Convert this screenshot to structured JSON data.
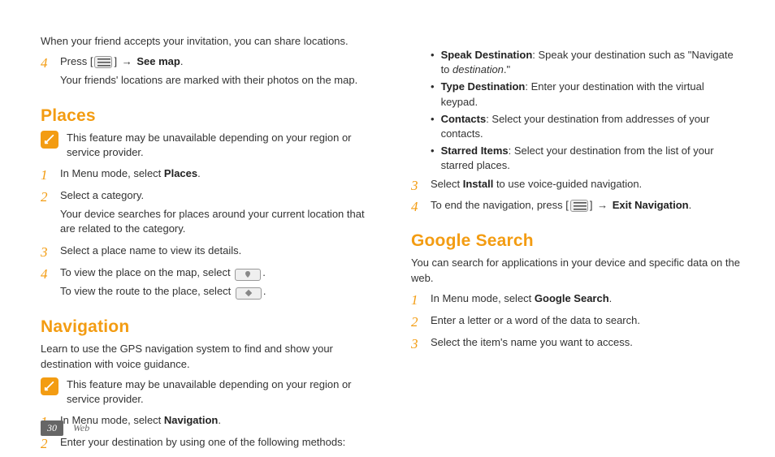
{
  "left": {
    "intro4_pre": "When your friend accepts your invitation, you can share locations.",
    "step4a_pre": "Press [",
    "step4a_arrow": " → ",
    "step4a_bold": "See map",
    "step4a_post": ".",
    "step4a_sub": "Your friends' locations are marked with their photos on the map.",
    "places_title": "Places",
    "places_note": "This feature may be unavailable depending on your region or service provider.",
    "places_step1_pre": "In Menu mode, select ",
    "places_step1_bold": "Places",
    "places_step1_post": ".",
    "places_step2": "Select a category.",
    "places_step2_sub": "Your device searches for places around your current location that are related to the category.",
    "places_step3": "Select a place name to view its details.",
    "places_step4_pre": "To view the place on the map, select ",
    "places_step4_post": ".",
    "places_step4b_pre": "To view the route to the place, select ",
    "places_step4b_post": ".",
    "nav_title": "Navigation",
    "nav_intro": "Learn to use the GPS navigation system to find and show your destination with voice guidance.",
    "nav_note": "This feature may be unavailable depending on your region or service provider.",
    "nav_step1_pre": "In Menu mode, select ",
    "nav_step1_bold": "Navigation",
    "nav_step1_post": ".",
    "nav_step2": "Enter your destination by using one of the following methods:"
  },
  "right": {
    "b1_bold": "Speak Destination",
    "b1_text_a": ": Speak your destination such as \"Navigate to ",
    "b1_text_i": "destination",
    "b1_text_b": ".\"",
    "b2_bold": "Type Destination",
    "b2_text": ": Enter your destination with the virtual keypad.",
    "b3_bold": "Contacts",
    "b3_text": ": Select your destination from addresses of your contacts.",
    "b4_bold": "Starred Items",
    "b4_text": ": Select your destination from the list of your starred places.",
    "step3_pre": "Select ",
    "step3_bold": "Install",
    "step3_post": " to use voice-guided navigation.",
    "step4_pre": "To end the navigation, press [",
    "step4_arrow": " → ",
    "step4_bold": "Exit Navigation",
    "step4_post": ".",
    "gs_title": "Google Search",
    "gs_intro": "You can search for applications in your device and specific data on the web.",
    "gs_step1_pre": "In Menu mode, select ",
    "gs_step1_bold": "Google Search",
    "gs_step1_post": ".",
    "gs_step2": "Enter a letter or a word of the data to search.",
    "gs_step3": "Select the item's name you want to access."
  },
  "nums": {
    "n1": "1",
    "n2": "2",
    "n3": "3",
    "n4": "4"
  },
  "footer": {
    "page": "30",
    "section": "Web"
  }
}
